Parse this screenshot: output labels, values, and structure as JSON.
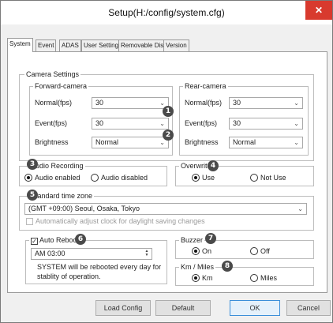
{
  "window": {
    "title": "Setup(H:/config/system.cfg)",
    "close_label": "✕"
  },
  "tabs": [
    "System",
    "Event",
    "ADAS",
    "User Settings",
    "Removable Disk",
    "Version"
  ],
  "camera_settings": {
    "legend": "Camera Settings",
    "forward": {
      "legend": "Forward-camera",
      "normal_label": "Normal(fps)",
      "normal_value": "30",
      "event_label": "Event(fps)",
      "event_value": "30",
      "brightness_label": "Brightness",
      "brightness_value": "Normal"
    },
    "rear": {
      "legend": "Rear-camera",
      "normal_label": "Normal(fps)",
      "normal_value": "30",
      "event_label": "Event(fps)",
      "event_value": "30",
      "brightness_label": "Brightness",
      "brightness_value": "Normal"
    }
  },
  "audio": {
    "legend": "Audio Recording",
    "enabled": "Audio enabled",
    "disabled": "Audio disabled"
  },
  "overwrite": {
    "legend": "Overwrite",
    "use": "Use",
    "not_use": "Not Use"
  },
  "timezone": {
    "legend": "Standard time zone",
    "value": "(GMT +09:00) Seoul, Osaka, Tokyo",
    "dst_label": "Automatically adjust clock for daylight saving changes"
  },
  "auto_reboot": {
    "legend": "Auto Reboot",
    "time": "AM 03:00",
    "note_line1": "SYSTEM will be rebooted every day for",
    "note_line2": "stablity of operation."
  },
  "buzzer": {
    "legend": "Buzzer",
    "on": "On",
    "off": "Off"
  },
  "units": {
    "legend": "Km / Miles",
    "km": "Km",
    "miles": "Miles"
  },
  "badges": [
    "1",
    "2",
    "3",
    "4",
    "5",
    "6",
    "7",
    "8"
  ],
  "buttons": {
    "load_config": "Load Config",
    "default": "Default",
    "ok": "OK",
    "cancel": "Cancel"
  },
  "icons": {
    "chevron": "chevron-down-icon",
    "check": "checkmark-icon"
  }
}
